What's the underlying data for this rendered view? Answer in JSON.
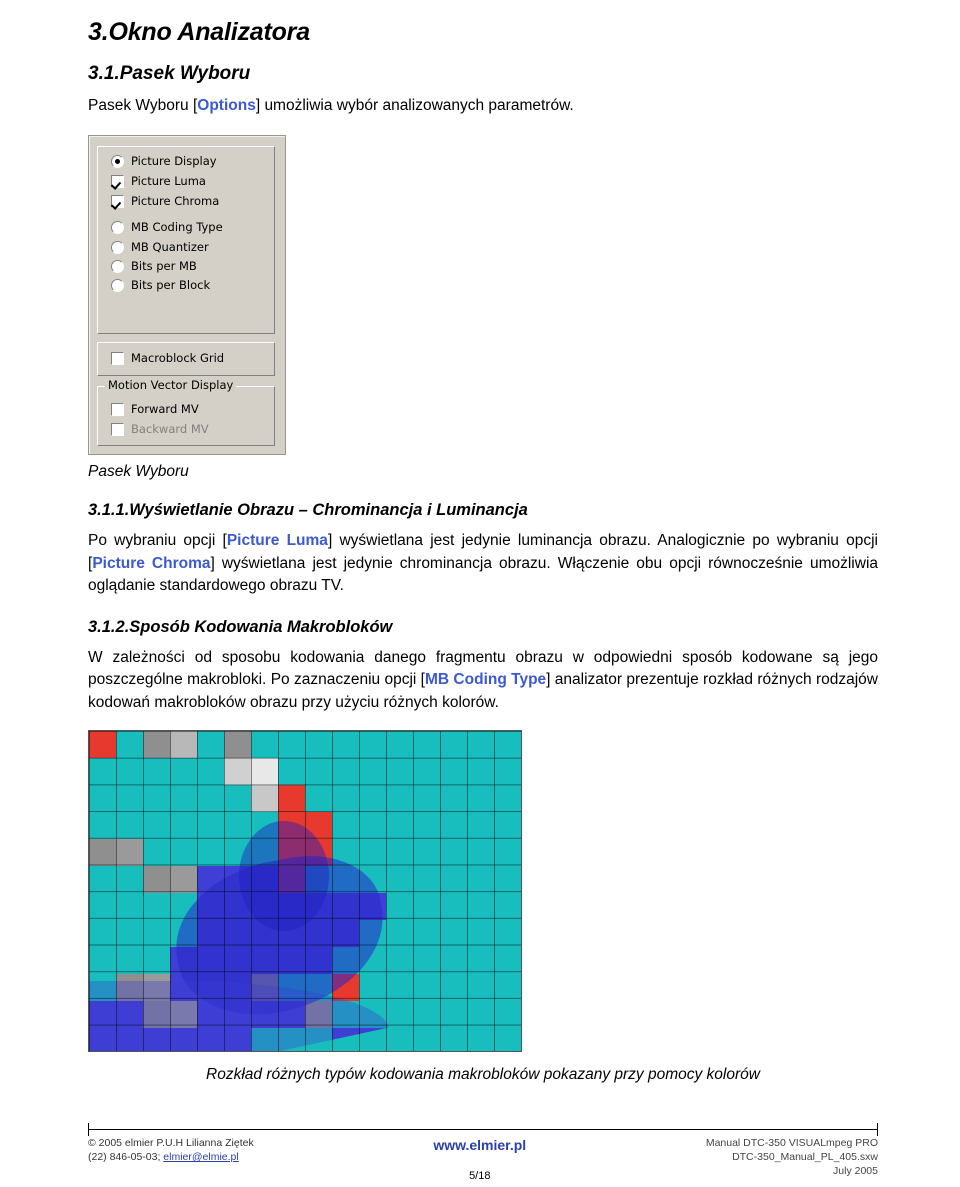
{
  "document": {
    "section_title": "3.Okno Analizatora",
    "subsection_title": "3.1.Pasek Wyboru",
    "intro_parts": {
      "a": "Pasek Wyboru [",
      "kw": "Options",
      "b": "] umożliwia wybór analizowanych parametrów."
    },
    "panel_caption": "Pasek Wyboru",
    "sub311": {
      "title": "3.1.1.Wyświetlanie Obrazu – Chrominancja i Luminancja",
      "p1_a": "Po wybraniu opcji [",
      "p1_kw": "Picture Luma",
      "p1_b": "] wyświetlana jest jedynie luminancja obrazu. Analogicznie po wybraniu opcji [",
      "p1_kw2": "Picture Chroma",
      "p1_c": "] wyświetlana jest jedynie chrominancja obrazu. Włączenie obu opcji równocześnie umożliwia oglądanie standardowego obrazu TV."
    },
    "sub312": {
      "title": "3.1.2.Sposób Kodowania Makrobloków",
      "p1_a": "W zależności od sposobu kodowania danego fragmentu obrazu w odpowiedni sposób kodowane są jego poszczególne makrobloki. Po zaznaczeniu opcji [",
      "p1_kw": "MB Coding Type",
      "p1_b": "] analizator prezentuje rozkład różnych rodzajów kodowań makrobloków obrazu przy użyciu różnych kolorów.",
      "image_caption": "Rozkład różnych typów kodowania makrobloków pokazany przy pomocy kolorów"
    }
  },
  "options_panel": {
    "groups": [
      {
        "legend": "",
        "items": [
          {
            "type": "radio",
            "label": "Picture Display",
            "checked": true
          },
          {
            "type": "checkbox",
            "label": "Picture Luma",
            "checked": true
          },
          {
            "type": "checkbox",
            "label": "Picture Chroma",
            "checked": true
          },
          {
            "type": "radio",
            "label": "MB Coding Type",
            "checked": false
          },
          {
            "type": "radio",
            "label": "MB Quantizer",
            "checked": false
          },
          {
            "type": "radio",
            "label": "Bits per MB",
            "checked": false
          },
          {
            "type": "radio",
            "label": "Bits per Block",
            "checked": false
          }
        ]
      },
      {
        "legend": "",
        "items": [
          {
            "type": "checkbox",
            "label": "Macroblock Grid",
            "checked": false
          }
        ]
      },
      {
        "legend": "Motion Vector Display",
        "items": [
          {
            "type": "checkbox",
            "label": "Forward MV",
            "checked": false
          },
          {
            "type": "checkbox",
            "label": "Backward MV",
            "checked": false,
            "disabled": true
          }
        ]
      }
    ]
  },
  "mb_image": {
    "colors": {
      "background": "#18bdbd",
      "red": "#e8392e",
      "blue": "#3f3fd8",
      "grey": "#8f8f8f",
      "light": "#d8d8d8"
    }
  },
  "footer": {
    "left_line1": "© 2005 elmier P.U.H Lilianna Ziętek",
    "left_line2_a": "(22) 846-05-03; ",
    "left_line2_link": "elmier@elmie.pl",
    "center_url": "www.elmier.pl",
    "page_number": "5/18",
    "right_line1": "Manual DTC-350 VISUALmpeg PRO",
    "right_line2": "DTC-350_Manual_PL_405.sxw",
    "right_line3": "July 2005"
  }
}
